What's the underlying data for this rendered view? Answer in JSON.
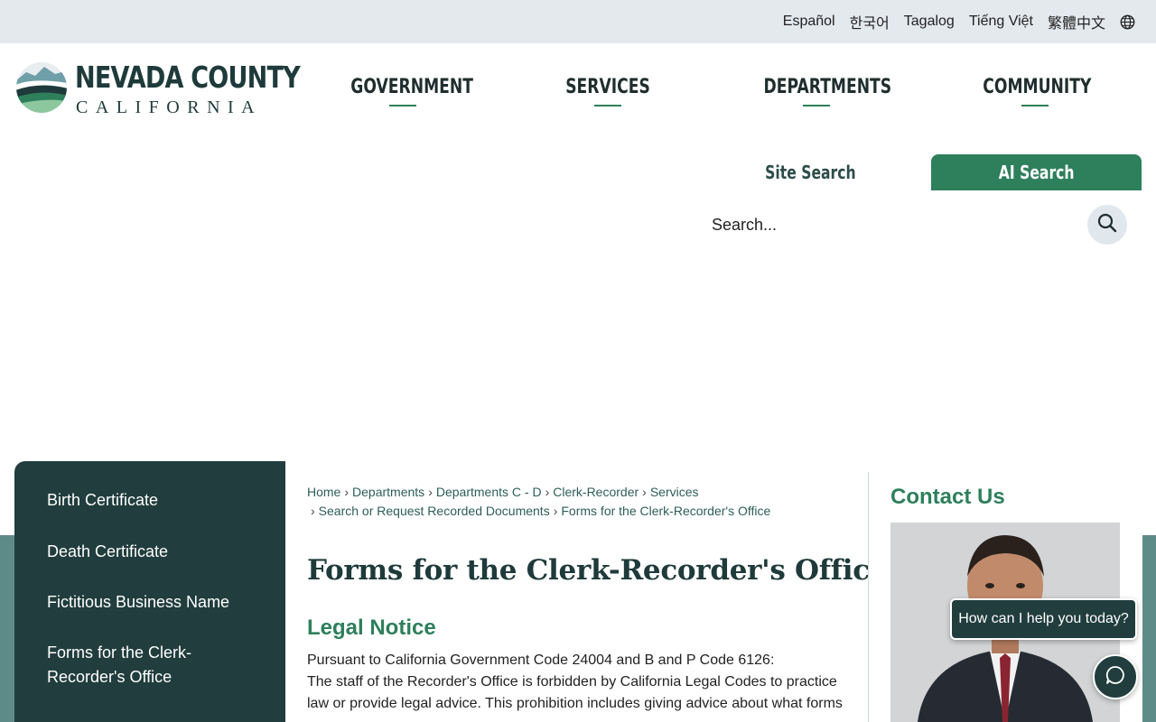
{
  "languages": [
    "Español",
    "한국어",
    "Tagalog",
    "Tiếng Việt",
    "繁體中文"
  ],
  "header": {
    "logo_line1": "NEVADA COUNTY",
    "logo_line2": "CALIFORNIA",
    "nav": [
      "GOVERNMENT",
      "SERVICES",
      "DEPARTMENTS",
      "COMMUNITY"
    ]
  },
  "search": {
    "tab_site": "Site Search",
    "tab_ai": "AI Search",
    "placeholder": "Search..."
  },
  "sidebar": {
    "items": [
      {
        "label": "Birth Certificate"
      },
      {
        "label": "Death Certificate"
      },
      {
        "label": "Fictitious Business Name"
      },
      {
        "label": "Forms for the Clerk-Recorder's Office"
      }
    ]
  },
  "breadcrumb": {
    "items": [
      "Home",
      "Departments",
      "Departments C - D",
      "Clerk-Recorder",
      "Services",
      "Search or Request Recorded Documents",
      "Forms for the Clerk-Recorder's Office"
    ]
  },
  "main": {
    "title": "Forms for the Clerk-Recorder's Office",
    "legal_heading": "Legal Notice",
    "legal_line1": "Pursuant to California Government Code 24004 and B and P Code 6126:",
    "legal_line2": "The staff of the Recorder's Office is forbidden by California Legal Codes to practice law or provide legal advice. This prohibition includes giving advice about what forms"
  },
  "contact": {
    "heading": "Contact Us"
  },
  "chat": {
    "prompt": "How can I help you today?"
  },
  "colors": {
    "brand_green": "#2e7f5c",
    "dark_teal": "#213d3d",
    "band_teal": "#5d8b88",
    "lang_bar": "#e4e9ee"
  }
}
